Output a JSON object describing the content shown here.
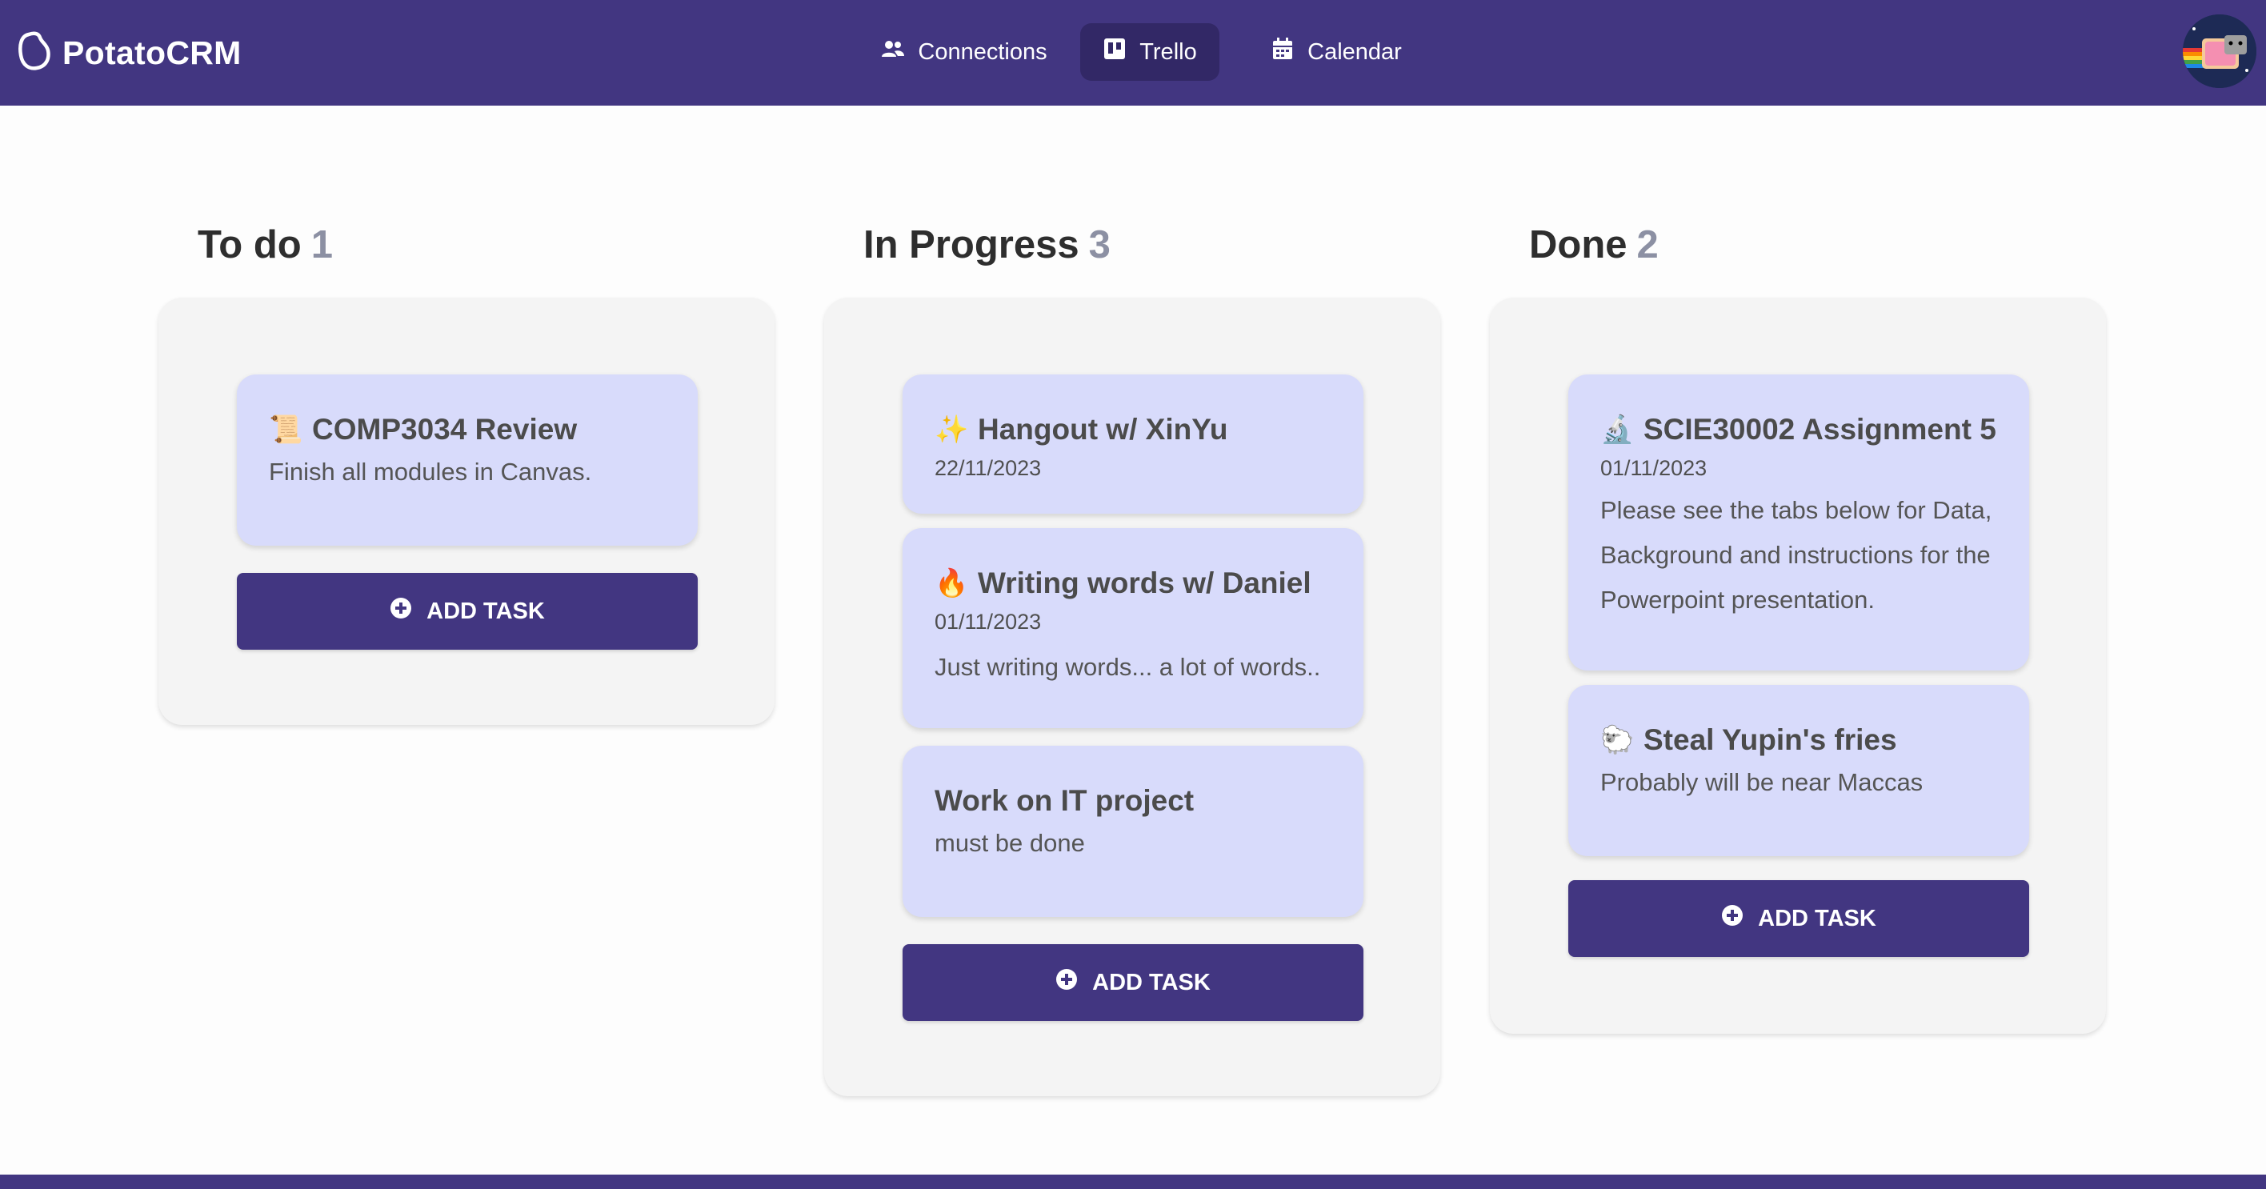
{
  "app": {
    "name": "PotatoCRM"
  },
  "nav": {
    "items": [
      {
        "label": "Connections",
        "icon": "users-icon"
      },
      {
        "label": "Trello",
        "icon": "trello-icon",
        "active": true
      },
      {
        "label": "Calendar",
        "icon": "calendar-icon"
      }
    ]
  },
  "colors": {
    "primary": "#423681",
    "card": "#d8dbfb",
    "panel": "#f4f4f4",
    "count": "#8c90a3"
  },
  "columns": [
    {
      "title": "To do",
      "count": "1",
      "cards": [
        {
          "icon": "📜",
          "title": "COMP3034 Review",
          "date": "",
          "description": "Finish all modules in Canvas."
        }
      ],
      "add_label": "ADD TASK"
    },
    {
      "title": "In Progress",
      "count": "3",
      "cards": [
        {
          "icon": "✨",
          "title": "Hangout w/ XinYu",
          "date": "22/11/2023",
          "description": ""
        },
        {
          "icon": "🔥",
          "title": "Writing words w/ Daniel",
          "date": "01/11/2023",
          "description": "Just writing words... a lot of words.."
        },
        {
          "icon": "",
          "title": "Work on IT project",
          "date": "",
          "description": "must be done"
        }
      ],
      "add_label": "ADD TASK"
    },
    {
      "title": "Done",
      "count": "2",
      "cards": [
        {
          "icon": "🔬",
          "title": "SCIE30002 Assignment 5",
          "date": "01/11/2023",
          "description": "Please see the tabs below for Data, Background and instructions for the Powerpoint presentation."
        },
        {
          "icon": "🐑",
          "title": "Steal Yupin's fries",
          "date": "",
          "description": "Probably will be near Maccas"
        }
      ],
      "add_label": "ADD TASK"
    }
  ]
}
